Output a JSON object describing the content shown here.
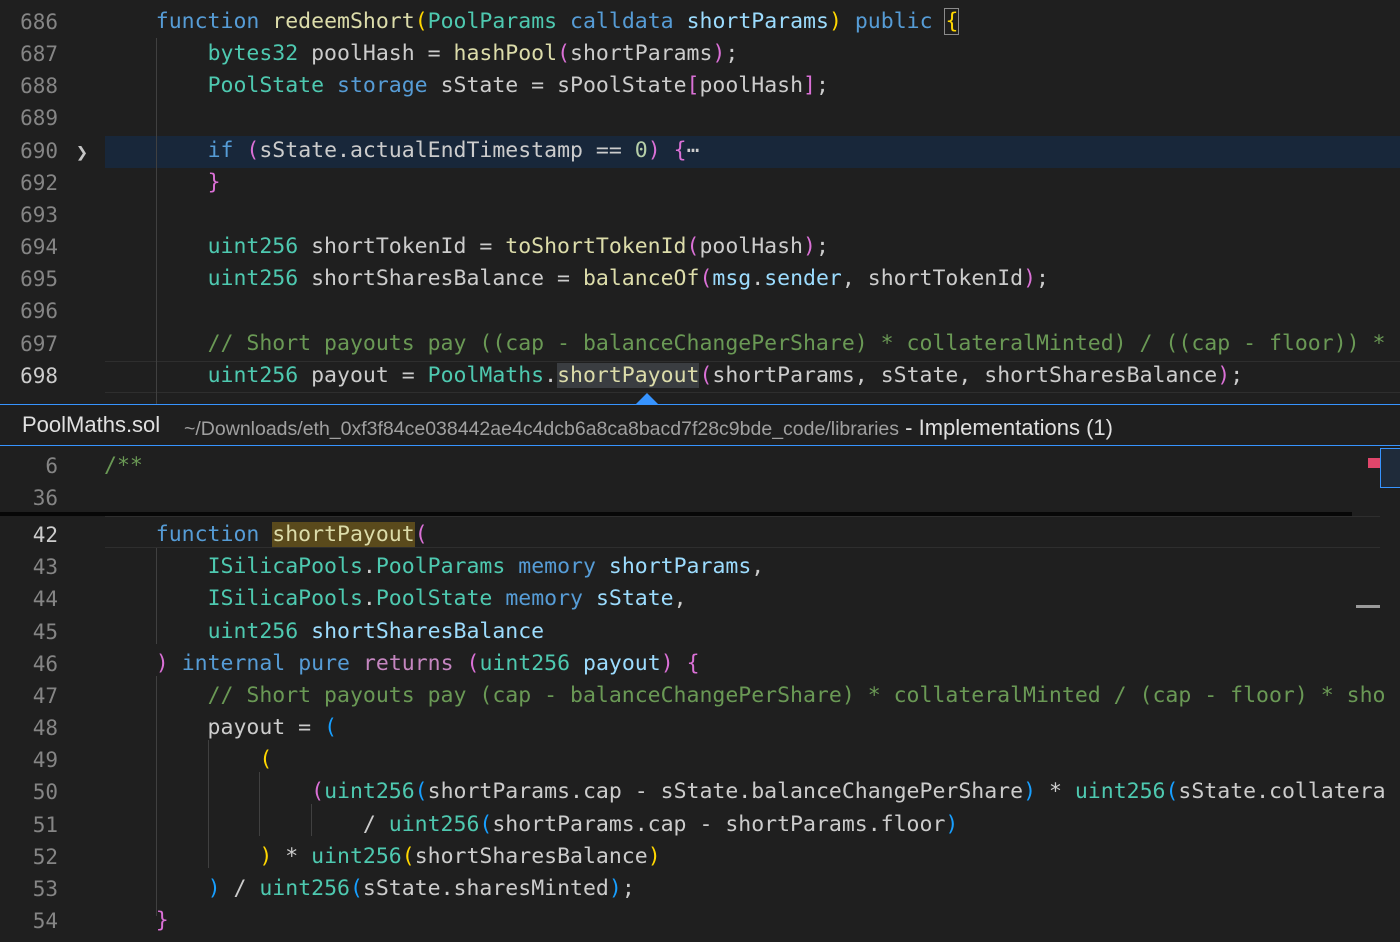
{
  "peek": {
    "filename": "PoolMaths.sol",
    "path": "~/Downloads/eth_0xf3f84ce038442ae4c4dcb6a8ca8bacd7f28c9bde_code/libraries",
    "separator": " - ",
    "title": "Implementations (1)"
  },
  "editor": {
    "lines": [
      {
        "num": "686",
        "tokens": [
          [
            "    ",
            "w"
          ],
          [
            "function",
            "k"
          ],
          [
            " ",
            "w"
          ],
          [
            "redeemShort",
            "f"
          ],
          [
            "(",
            "b1"
          ],
          [
            "PoolParams",
            "t"
          ],
          [
            " ",
            "w"
          ],
          [
            "calldata",
            "k"
          ],
          [
            " ",
            "w"
          ],
          [
            "shortParams",
            "v"
          ],
          [
            ")",
            "b1"
          ],
          [
            " ",
            "w"
          ],
          [
            "public",
            "k"
          ],
          [
            " ",
            "w"
          ],
          [
            "{",
            "b1 bracketbox"
          ]
        ]
      },
      {
        "num": "687",
        "tokens": [
          [
            "        ",
            "w"
          ],
          [
            "bytes32",
            "t"
          ],
          [
            " poolHash = ",
            "w"
          ],
          [
            "hashPool",
            "f"
          ],
          [
            "(",
            "b2"
          ],
          [
            "shortParams",
            "w"
          ],
          [
            ")",
            "b2"
          ],
          [
            ";",
            "w"
          ]
        ]
      },
      {
        "num": "688",
        "tokens": [
          [
            "        ",
            "w"
          ],
          [
            "PoolState",
            "t"
          ],
          [
            " ",
            "w"
          ],
          [
            "storage",
            "k"
          ],
          [
            " sState = sPoolState",
            "w"
          ],
          [
            "[",
            "b2"
          ],
          [
            "poolHash",
            "w"
          ],
          [
            "]",
            "b2"
          ],
          [
            ";",
            "w"
          ]
        ]
      },
      {
        "num": "689",
        "tokens": []
      },
      {
        "num": "690",
        "tokens": [
          [
            "        ",
            "w"
          ],
          [
            "if",
            "k"
          ],
          [
            " ",
            "w"
          ],
          [
            "(",
            "b2"
          ],
          [
            "sState.actualEndTimestamp == ",
            "w"
          ],
          [
            "0",
            "n"
          ],
          [
            ")",
            "b2"
          ],
          [
            " ",
            "w"
          ],
          [
            "{",
            "b2"
          ],
          [
            "⋯",
            "w"
          ]
        ]
      },
      {
        "num": "692",
        "tokens": [
          [
            "        ",
            "w"
          ],
          [
            "}",
            "b2"
          ]
        ]
      },
      {
        "num": "693",
        "tokens": []
      },
      {
        "num": "694",
        "tokens": [
          [
            "        ",
            "w"
          ],
          [
            "uint256",
            "t"
          ],
          [
            " shortTokenId = ",
            "w"
          ],
          [
            "toShortTokenId",
            "f"
          ],
          [
            "(",
            "b2"
          ],
          [
            "poolHash",
            "w"
          ],
          [
            ")",
            "b2"
          ],
          [
            ";",
            "w"
          ]
        ]
      },
      {
        "num": "695",
        "tokens": [
          [
            "        ",
            "w"
          ],
          [
            "uint256",
            "t"
          ],
          [
            " shortSharesBalance = ",
            "w"
          ],
          [
            "balanceOf",
            "f"
          ],
          [
            "(",
            "b2"
          ],
          [
            "msg",
            "v"
          ],
          [
            ".",
            "w"
          ],
          [
            "sender",
            "v"
          ],
          [
            ", shortTokenId",
            "w"
          ],
          [
            ")",
            "b2"
          ],
          [
            ";",
            "w"
          ]
        ]
      },
      {
        "num": "696",
        "tokens": []
      },
      {
        "num": "697",
        "tokens": [
          [
            "        ",
            "w"
          ],
          [
            "// Short payouts pay ((cap - balanceChangePerShare) * collateralMinted) / ((cap - floor)) * ",
            "m"
          ]
        ]
      },
      {
        "num": "698",
        "tokens": [
          [
            "        ",
            "w"
          ],
          [
            "uint256",
            "t"
          ],
          [
            " payout = ",
            "w"
          ],
          [
            "PoolMaths",
            "t"
          ],
          [
            ".",
            "w"
          ],
          [
            "shortPayout",
            "f hlword"
          ],
          [
            "(",
            "b2"
          ],
          [
            "shortParams, sState, shortSharesBalance",
            "w"
          ],
          [
            ")",
            "b2"
          ],
          [
            ";",
            "w"
          ]
        ]
      }
    ]
  },
  "peek_code": {
    "lines": [
      {
        "num": "6",
        "tokens": [
          [
            "/**",
            "m"
          ]
        ]
      },
      {
        "num": "36",
        "tokens": []
      },
      {
        "num": "42",
        "tokens": [
          [
            "    ",
            "w"
          ],
          [
            "function",
            "k"
          ],
          [
            " ",
            "w"
          ],
          [
            "shortPayout",
            "f hlword2"
          ],
          [
            "(",
            "b2"
          ]
        ]
      },
      {
        "num": "43",
        "tokens": [
          [
            "        ",
            "w"
          ],
          [
            "ISilicaPools",
            "t"
          ],
          [
            ".",
            "w"
          ],
          [
            "PoolParams",
            "t"
          ],
          [
            " ",
            "w"
          ],
          [
            "memory",
            "k"
          ],
          [
            " ",
            "w"
          ],
          [
            "shortParams",
            "v"
          ],
          [
            ",",
            "w"
          ]
        ]
      },
      {
        "num": "44",
        "tokens": [
          [
            "        ",
            "w"
          ],
          [
            "ISilicaPools",
            "t"
          ],
          [
            ".",
            "w"
          ],
          [
            "PoolState",
            "t"
          ],
          [
            " ",
            "w"
          ],
          [
            "memory",
            "k"
          ],
          [
            " ",
            "w"
          ],
          [
            "sState",
            "v"
          ],
          [
            ",",
            "w"
          ]
        ]
      },
      {
        "num": "45",
        "tokens": [
          [
            "        ",
            "w"
          ],
          [
            "uint256",
            "t"
          ],
          [
            " ",
            "w"
          ],
          [
            "shortSharesBalance",
            "v"
          ]
        ]
      },
      {
        "num": "46",
        "tokens": [
          [
            "    ",
            "w"
          ],
          [
            ")",
            "b2"
          ],
          [
            " ",
            "w"
          ],
          [
            "internal",
            "k"
          ],
          [
            " ",
            "w"
          ],
          [
            "pure",
            "k"
          ],
          [
            " ",
            "w"
          ],
          [
            "returns",
            "c"
          ],
          [
            " ",
            "w"
          ],
          [
            "(",
            "b2"
          ],
          [
            "uint256",
            "t"
          ],
          [
            " ",
            "w"
          ],
          [
            "payout",
            "v"
          ],
          [
            ")",
            "b2"
          ],
          [
            " ",
            "w"
          ],
          [
            "{",
            "b2"
          ]
        ]
      },
      {
        "num": "47",
        "tokens": [
          [
            "        ",
            "w"
          ],
          [
            "// Short payouts pay (cap - balanceChangePerShare) * collateralMinted / (cap - floor) * sho",
            "m"
          ]
        ]
      },
      {
        "num": "48",
        "tokens": [
          [
            "        payout = ",
            "w"
          ],
          [
            "(",
            "b3"
          ]
        ]
      },
      {
        "num": "49",
        "tokens": [
          [
            "            ",
            "w"
          ],
          [
            "(",
            "b1"
          ]
        ]
      },
      {
        "num": "50",
        "tokens": [
          [
            "                ",
            "w"
          ],
          [
            "(",
            "b2"
          ],
          [
            "uint256",
            "t"
          ],
          [
            "(",
            "b3"
          ],
          [
            "shortParams.cap - sState.balanceChangePerShare",
            "w"
          ],
          [
            ")",
            "b3"
          ],
          [
            " * ",
            "w"
          ],
          [
            "uint256",
            "t"
          ],
          [
            "(",
            "b3"
          ],
          [
            "sState.collatera",
            "w"
          ]
        ]
      },
      {
        "num": "51",
        "tokens": [
          [
            "                    / ",
            "w"
          ],
          [
            "uint256",
            "t"
          ],
          [
            "(",
            "b3"
          ],
          [
            "shortParams.cap - shortParams.floor",
            "w"
          ],
          [
            ")",
            "b3"
          ]
        ]
      },
      {
        "num": "52",
        "tokens": [
          [
            "            ",
            "w"
          ],
          [
            ")",
            "b1"
          ],
          [
            " * ",
            "w"
          ],
          [
            "uint256",
            "t"
          ],
          [
            "(",
            "b1"
          ],
          [
            "shortSharesBalance",
            "w"
          ],
          [
            ")",
            "b1"
          ]
        ]
      },
      {
        "num": "53",
        "tokens": [
          [
            "        ",
            "w"
          ],
          [
            ")",
            "b3"
          ],
          [
            " / ",
            "w"
          ],
          [
            "uint256",
            "t"
          ],
          [
            "(",
            "b3"
          ],
          [
            "sState.sharesMinted",
            "w"
          ],
          [
            ")",
            "b3"
          ],
          [
            ";",
            "w"
          ]
        ]
      },
      {
        "num": "54",
        "tokens": [
          [
            "    ",
            "w"
          ],
          [
            "}",
            "b2"
          ]
        ]
      }
    ]
  }
}
